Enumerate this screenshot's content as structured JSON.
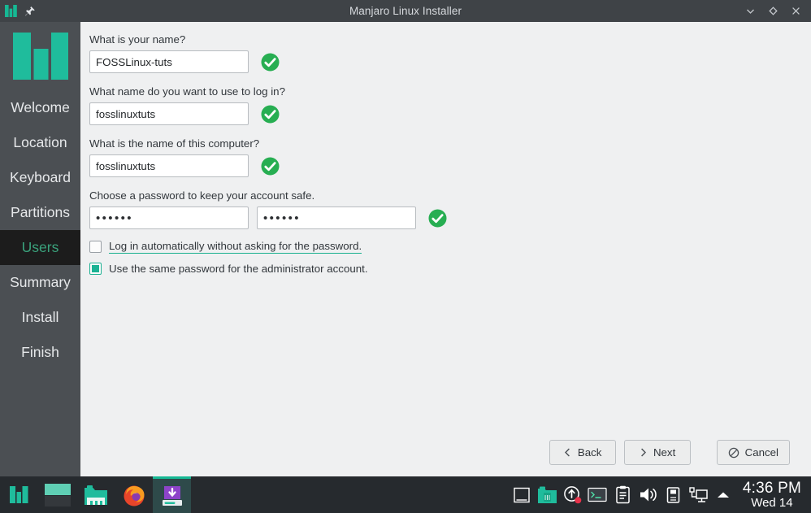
{
  "window": {
    "title": "Manjaro Linux Installer",
    "app_icon": "manjaro-logo-icon",
    "pin_icon": "pin-icon",
    "controls": [
      {
        "name": "minimize-button",
        "icon": "chevron-down-icon"
      },
      {
        "name": "maximize-button",
        "icon": "diamond-icon"
      },
      {
        "name": "close-button",
        "icon": "close-icon"
      }
    ]
  },
  "sidebar": {
    "logo_icon": "manjaro-logo-icon",
    "items": [
      {
        "label": "Welcome",
        "active": false
      },
      {
        "label": "Location",
        "active": false
      },
      {
        "label": "Keyboard",
        "active": false
      },
      {
        "label": "Partitions",
        "active": false
      },
      {
        "label": "Users",
        "active": true
      },
      {
        "label": "Summary",
        "active": false
      },
      {
        "label": "Install",
        "active": false
      },
      {
        "label": "Finish",
        "active": false
      }
    ]
  },
  "form": {
    "fields": [
      {
        "label": "What is your name?",
        "value": "FOSSLinux-tuts",
        "placeholder": "",
        "valid": true,
        "valid_icon": "check-circle-icon"
      },
      {
        "label": "What name do you want to use to log in?",
        "value": "fosslinuxtuts",
        "placeholder": "",
        "valid": true,
        "valid_icon": "check-circle-icon"
      },
      {
        "label": "What is the name of this computer?",
        "value": "fosslinuxtuts",
        "placeholder": "",
        "valid": true,
        "valid_icon": "check-circle-icon"
      }
    ],
    "password": {
      "label": "Choose a password to keep your account safe.",
      "value": "••••••",
      "confirm_value": "••••••",
      "valid": true,
      "valid_icon": "check-circle-icon"
    },
    "checkboxes": [
      {
        "label": "Log in automatically without asking for the password.",
        "checked": false,
        "hovered": true
      },
      {
        "label": "Use the same password for the administrator account.",
        "checked": true,
        "hovered": false
      }
    ]
  },
  "buttons": [
    {
      "name": "back-button",
      "label": "Back",
      "icon": "chevron-left-icon"
    },
    {
      "name": "next-button",
      "label": "Next",
      "icon": "chevron-right-icon"
    },
    {
      "name": "cancel-button",
      "label": "Cancel",
      "icon": "no-entry-icon"
    }
  ],
  "taskbar": {
    "launchers": [
      {
        "name": "taskbar-menu-manjaro",
        "icon": "manjaro-menu-icon",
        "active": false
      },
      {
        "name": "taskbar-pager",
        "icon": "desktop-pager-icon",
        "active": false
      },
      {
        "name": "taskbar-file-manager",
        "icon": "file-manager-icon",
        "active": false
      },
      {
        "name": "taskbar-firefox",
        "icon": "firefox-icon",
        "active": false
      },
      {
        "name": "taskbar-installer",
        "icon": "installer-icon",
        "active": true
      }
    ],
    "tray": [
      {
        "name": "tray-show-desktop",
        "icon": "window-icon"
      },
      {
        "name": "tray-trash",
        "icon": "trash-folder-icon"
      },
      {
        "name": "tray-updates",
        "icon": "update-notifier-icon"
      },
      {
        "name": "tray-terminal",
        "icon": "terminal-icon"
      },
      {
        "name": "tray-clipboard",
        "icon": "clipboard-icon"
      },
      {
        "name": "tray-volume",
        "icon": "speaker-icon"
      },
      {
        "name": "tray-removable-media",
        "icon": "usb-drive-icon"
      },
      {
        "name": "tray-network",
        "icon": "network-icon"
      },
      {
        "name": "tray-expand",
        "icon": "chevron-up-icon"
      }
    ],
    "clock": {
      "time": "4:36 PM",
      "date": "Wed 14"
    }
  },
  "colors": {
    "accent_teal": "#1ab394",
    "titlebar_bg": "#3f4347",
    "sidebar_bg": "#4b4f53",
    "sidebar_active_bg": "#1c1c1c",
    "sidebar_active_text": "#3aa27c",
    "panel_bg": "#eff0f1",
    "taskbar_bg": "#262a2e",
    "valid_green": "#27ae52"
  }
}
